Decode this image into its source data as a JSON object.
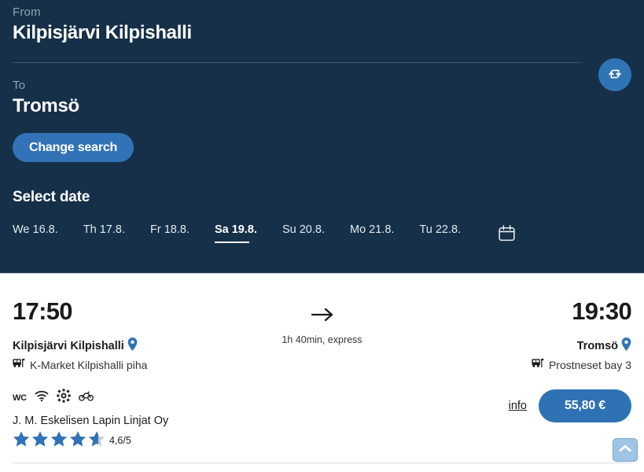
{
  "search": {
    "from_label": "From",
    "from_value": "Kilpisjärvi Kilpishalli",
    "to_label": "To",
    "to_value": "Tromsö",
    "swap_icon": "swap-arrows-icon",
    "change_search_label": "Change search",
    "select_date_label": "Select date",
    "calendar_icon": "calendar-icon",
    "dates": [
      {
        "label": "We 16.8.",
        "active": false
      },
      {
        "label": "Th 17.8.",
        "active": false
      },
      {
        "label": "Fr 18.8.",
        "active": false
      },
      {
        "label": "Sa 19.8.",
        "active": true
      },
      {
        "label": "Su 20.8.",
        "active": false
      },
      {
        "label": "Mo 21.8.",
        "active": false
      },
      {
        "label": "Tu 22.8.",
        "active": false
      }
    ]
  },
  "journey": {
    "departure_time": "17:50",
    "departure_stop": "Kilpisjärvi Kilpishalli",
    "departure_platform": "K-Market Kilpishalli piha",
    "arrival_time": "19:30",
    "arrival_stop": "Tromsö",
    "arrival_platform": "Prostneset bay 3",
    "duration": "1h 40min, express",
    "arrow_icon": "arrow-right-icon",
    "pin_icon": "location-pin-icon",
    "bus_stop_icon": "bus-stop-icon",
    "amenities": [
      {
        "name": "wc-icon",
        "label": "WC"
      },
      {
        "name": "wifi-icon",
        "label": ""
      },
      {
        "name": "air-conditioning-icon",
        "label": ""
      },
      {
        "name": "bicycle-icon",
        "label": ""
      }
    ],
    "operator": "J. M. Eskelisen Lapin Linjat Oy",
    "rating_value": "4,6/5",
    "rating_stars": 4.6,
    "info_label": "info",
    "price": "55,80 €"
  },
  "scroll_top": {
    "icon": "chevron-up-icon"
  },
  "colors": {
    "header_bg": "#153048",
    "accent_blue": "#2f74b5",
    "button_blue": "#3273b8",
    "price_blue": "#2e72b4",
    "star_blue": "#3273b8",
    "muted_label": "#93a3b3",
    "scroll_top_bg": "#9fc4e5"
  }
}
